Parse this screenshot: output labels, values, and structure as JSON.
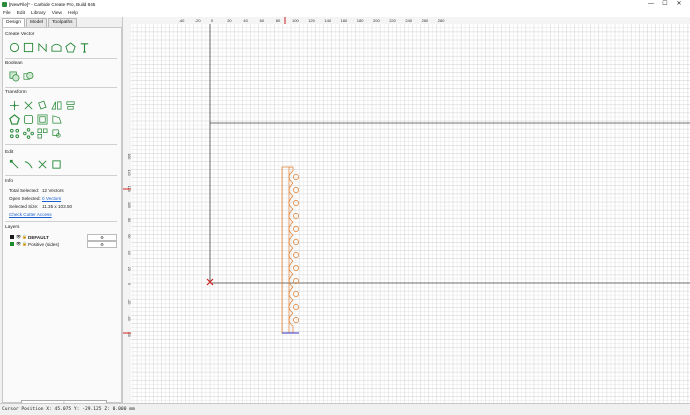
{
  "window": {
    "title": "[NewFile]* - Carbide Create Pro, Build 845",
    "min": "—",
    "max": "☐",
    "close": "✕"
  },
  "menu": [
    "File",
    "Edit",
    "Library",
    "View",
    "Help"
  ],
  "tabs": [
    "Design",
    "Model",
    "Toolpaths"
  ],
  "sections": {
    "create_vector": "Create Vector",
    "boolean": "Boolean",
    "transform": "Transform",
    "edit": "Edit",
    "info": "Info",
    "layers": "Layers"
  },
  "info": {
    "total_selected_label": "Total Selected:",
    "total_selected_value": "12 Vectors",
    "open_selected_label": "Open Selected:",
    "open_selected_value": "0 Vectors",
    "selected_size_label": "Selected Size:",
    "selected_size_value": "11.35 x 103.50",
    "check_cutter": "Check Cutter Access"
  },
  "layers": [
    {
      "name": "DEFAULT",
      "color": "#1a1a1a",
      "gear": "⚙"
    },
    {
      "name": "Positive (sides)",
      "color": "#1f8a2c",
      "gear": "⚙"
    }
  ],
  "add_layer": "+",
  "status": "Cursor Position X: 45.075 Y: -29.125 Z: 0.000 mm",
  "ruler": {
    "h_labels": [
      "-40",
      "-20",
      "0",
      "20",
      "40",
      "60",
      "80",
      "100",
      "120",
      "140",
      "160",
      "180",
      "200",
      "220",
      "240",
      "260",
      "280"
    ],
    "v_labels": [
      "160",
      "140",
      "120",
      "100",
      "80",
      "60",
      "40",
      "20",
      "0",
      "-20",
      "-40",
      "-60"
    ]
  },
  "colors": {
    "accent": "#2a8a3a",
    "shape": "#e07b2a",
    "axis": "#d02020",
    "selection": "#3030c0"
  }
}
